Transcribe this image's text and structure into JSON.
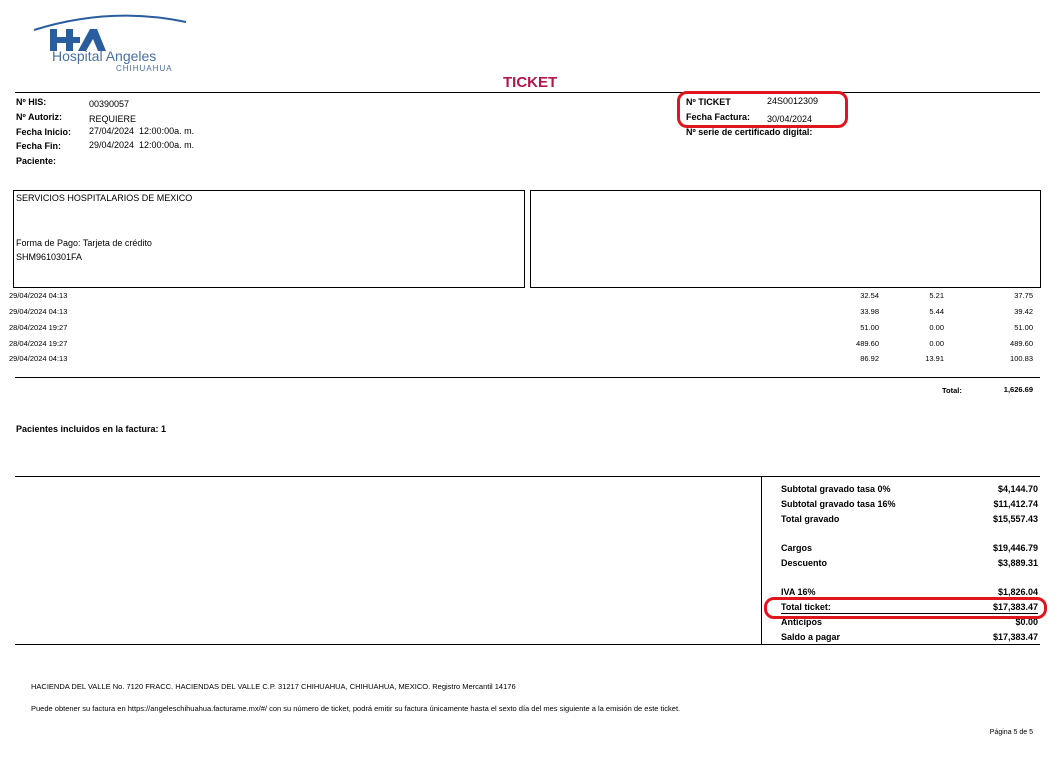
{
  "logo": {
    "name": "Hospital Angeles",
    "subtitle": "CHIHUAHUA",
    "colors": {
      "blue": "#2a5d9e",
      "text": "#4a6fa5"
    }
  },
  "title": "TICKET",
  "title_color": "#b3154d",
  "header_left": [
    {
      "label": "Nº HIS:",
      "value": "00390057"
    },
    {
      "label": "Nº Autoriz:",
      "value": "REQUIERE"
    },
    {
      "label": "Fecha Inicio:",
      "value": "27/04/2024  12:00:00a. m."
    },
    {
      "label": "Fecha Fin:",
      "value": "29/04/2024  12:00:00a. m."
    },
    {
      "label": "Paciente:",
      "value": ""
    }
  ],
  "header_right": {
    "ticket_label": "Nº TICKET",
    "ticket_value": "24S0012309",
    "fecha_label": "Fecha Factura:",
    "fecha_value": "30/04/2024",
    "serie_label": "Nº serie de certificado digital:"
  },
  "client_box": {
    "name": "SERVICIOS HOSPITALARIOS DE MEXICO",
    "payment": "Forma de Pago: Tarjeta de crédito",
    "rfc": "SHM9610301FA"
  },
  "line_items": [
    {
      "date": "29/04/2024 04:13",
      "amount": "32.54",
      "tax": "5.21",
      "total": "37.75"
    },
    {
      "date": "29/04/2024 04:13",
      "amount": "33.98",
      "tax": "5.44",
      "total": "39.42"
    },
    {
      "date": "28/04/2024 19:27",
      "amount": "51.00",
      "tax": "0.00",
      "total": "51.00"
    },
    {
      "date": "28/04/2024 19:27",
      "amount": "489.60",
      "tax": "0.00",
      "total": "489.60"
    },
    {
      "date": "29/04/2024 04:13",
      "amount": "86.92",
      "tax": "13.91",
      "total": "100.83"
    }
  ],
  "items_total": {
    "label": "Total:",
    "value": "1,626.69"
  },
  "patients_included": "Pacientes incluidos en la factura: 1",
  "summary": {
    "subtotal_0_label": "Subtotal gravado tasa 0%",
    "subtotal_0_value": "$4,144.70",
    "subtotal_16_label": "Subtotal gravado tasa 16%",
    "subtotal_16_value": "$11,412.74",
    "total_gravado_label": "Total gravado",
    "total_gravado_value": "$15,557.43",
    "cargos_label": "Cargos",
    "cargos_value": "$19,446.79",
    "descuento_label": "Descuento",
    "descuento_value": "$3,889.31",
    "iva_label": "IVA 16%",
    "iva_value": "$1,826.04",
    "total_ticket_label": "Total ticket:",
    "total_ticket_value": "$17,383.47",
    "anticipos_label": "Anticipos",
    "anticipos_value": "$0.00",
    "saldo_label": "Saldo a pagar",
    "saldo_value": "$17,383.47"
  },
  "footer": {
    "address": "HACIENDA DEL VALLE No. 7120 FRACC. HACIENDAS DEL VALLE C.P. 31217 CHIHUAHUA, CHIHUAHUA, MEXICO. Registro Mercantil 14176",
    "invoice_note": "Puede obtener su factura en https://angeleschihuahua.facturame.mx/#/ con su número de ticket, podrá emitir su factura únicamente hasta el sexto día del mes siguiente a la emisión de este ticket.",
    "page": "Página 5 de 5"
  },
  "highlight_color": "#e0161e"
}
